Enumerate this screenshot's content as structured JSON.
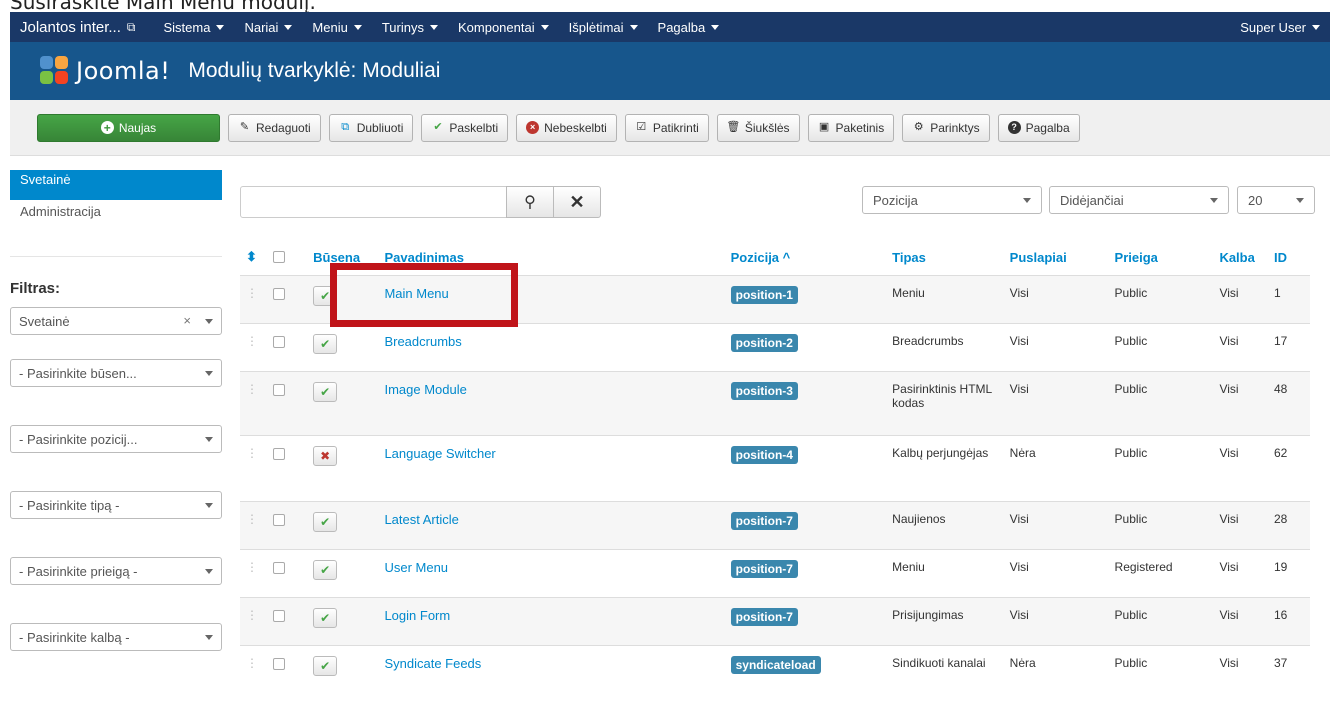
{
  "caption": "Susiraskite Main Menu modulį.",
  "navbar": {
    "site": "Jolantos inter...",
    "menu": [
      "Sistema",
      "Nariai",
      "Meniu",
      "Turinys",
      "Komponentai",
      "Išplėtimai",
      "Pagalba"
    ],
    "user": "Super User"
  },
  "header": {
    "logo_text": "Joomla!",
    "title": "Modulių tvarkyklė: Moduliai",
    "colors": {
      "navbar": "#1a3867",
      "header": "#17568c",
      "accent": "#0088cc",
      "new_button": "#46a546"
    }
  },
  "toolbar": {
    "new": "Naujas",
    "edit": "Redaguoti",
    "duplicate": "Dubliuoti",
    "publish": "Paskelbti",
    "unpublish": "Nebeskelbti",
    "check": "Patikrinti",
    "trash": "Šiukšlės",
    "batch": "Paketinis",
    "options": "Parinktys",
    "help": "Pagalba"
  },
  "sidebar": {
    "items": [
      "Svetainė",
      "Administracija"
    ],
    "filter_title": "Filtras:",
    "filters": [
      "Svetainė",
      "- Pasirinkite būsen...",
      "- Pasirinkite pozicij...",
      "- Pasirinkite tipą -",
      "- Pasirinkite prieigą -",
      "- Pasirinkite kalbą -"
    ]
  },
  "list_controls": {
    "search_placeholder": "",
    "sort_field": "Pozicija",
    "sort_dir": "Didėjančiai",
    "limit": "20"
  },
  "table": {
    "headers": {
      "status": "Būsena",
      "title": "Pavadinimas",
      "position": "Pozicija ^",
      "type": "Tipas",
      "pages": "Puslapiai",
      "access": "Prieiga",
      "language": "Kalba",
      "id": "ID"
    },
    "rows": [
      {
        "title": "Main Menu",
        "position": "position-1",
        "type": "Meniu",
        "pages": "Visi",
        "access": "Public",
        "language": "Visi",
        "id": "1",
        "published": true
      },
      {
        "title": "Breadcrumbs",
        "position": "position-2",
        "type": "Breadcrumbs",
        "pages": "Visi",
        "access": "Public",
        "language": "Visi",
        "id": "17",
        "published": true
      },
      {
        "title": "Image Module",
        "position": "position-3",
        "type": "Pasirinktinis HTML kodas",
        "pages": "Visi",
        "access": "Public",
        "language": "Visi",
        "id": "48",
        "published": true
      },
      {
        "title": "Language Switcher",
        "position": "position-4",
        "type": "Kalbų perjungėjas",
        "pages": "Nėra",
        "access": "Public",
        "language": "Visi",
        "id": "62",
        "published": false
      },
      {
        "title": "Latest Article",
        "position": "position-7",
        "type": "Naujienos",
        "pages": "Visi",
        "access": "Public",
        "language": "Visi",
        "id": "28",
        "published": true
      },
      {
        "title": "User Menu",
        "position": "position-7",
        "type": "Meniu",
        "pages": "Visi",
        "access": "Registered",
        "language": "Visi",
        "id": "19",
        "published": true
      },
      {
        "title": "Login Form",
        "position": "position-7",
        "type": "Prisijungimas",
        "pages": "Visi",
        "access": "Public",
        "language": "Visi",
        "id": "16",
        "published": true
      },
      {
        "title": "Syndicate Feeds",
        "position": "syndicateload",
        "type": "Sindikuoti kanalai",
        "pages": "Nėra",
        "access": "Public",
        "language": "Visi",
        "id": "37",
        "published": true
      }
    ]
  }
}
